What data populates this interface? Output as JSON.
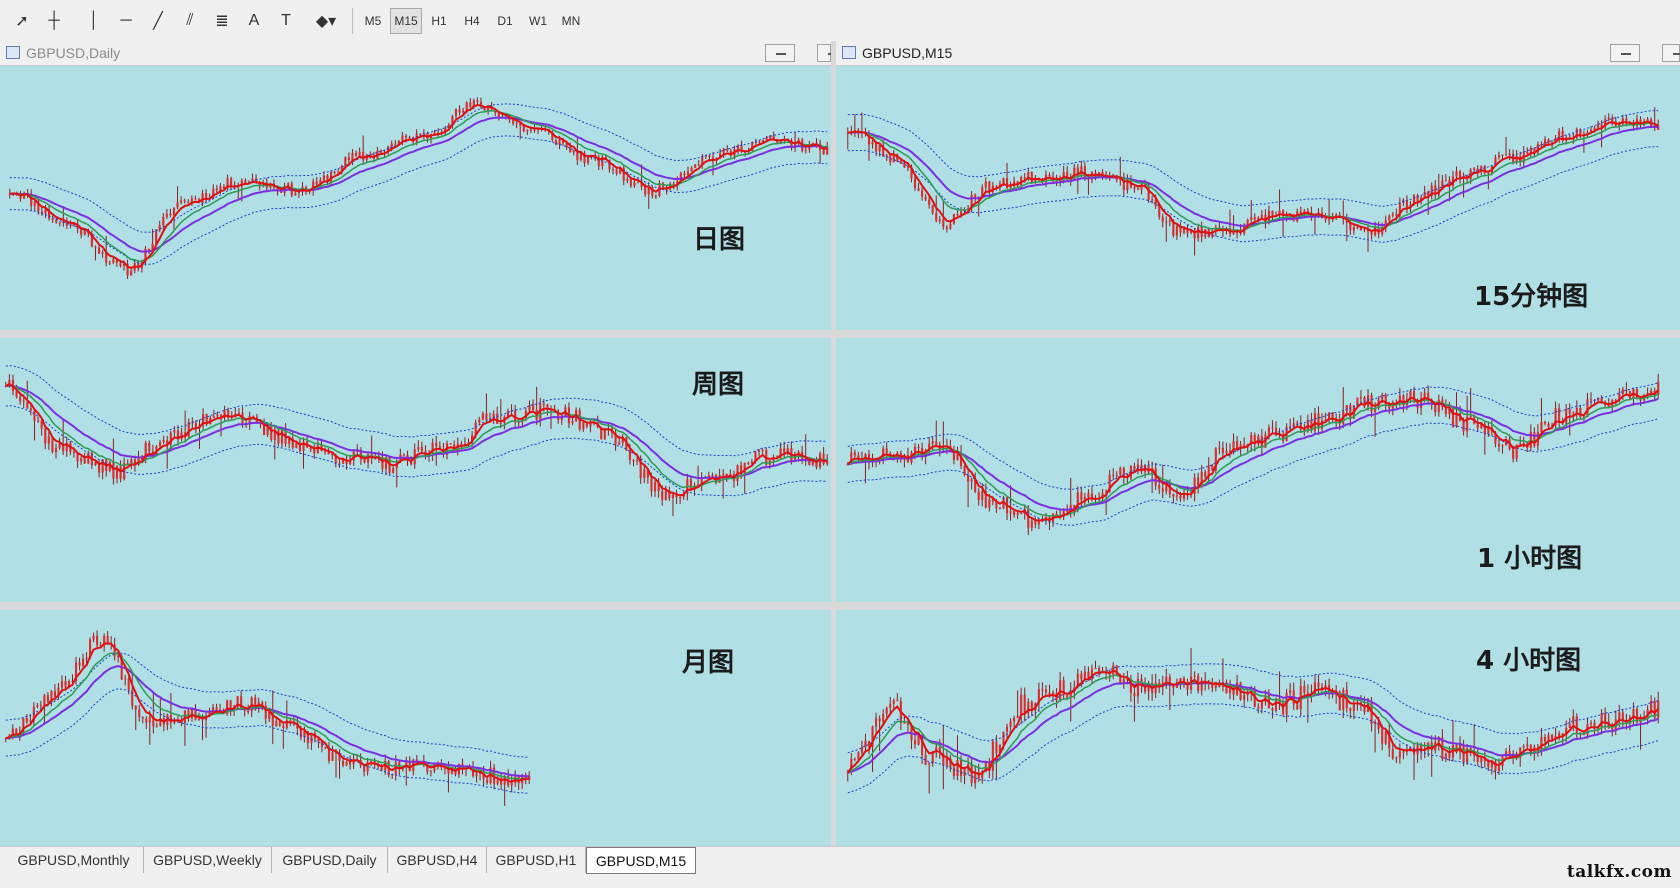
{
  "toolbar": {
    "tools": [
      {
        "name": "cursor-icon",
        "glyph": "➚"
      },
      {
        "name": "crosshair-icon",
        "glyph": "┼"
      },
      {
        "name": "vertical-line-icon",
        "glyph": "│"
      },
      {
        "name": "horizontal-line-icon",
        "glyph": "─"
      },
      {
        "name": "trendline-icon",
        "glyph": "╱"
      },
      {
        "name": "equidistant-channel-icon",
        "glyph": "⫽"
      },
      {
        "name": "fibonacci-icon",
        "glyph": "≣"
      },
      {
        "name": "text-icon",
        "glyph": "A"
      },
      {
        "name": "text-label-icon",
        "glyph": "T"
      },
      {
        "name": "arrows-dropdown-icon",
        "glyph": "◆▾"
      }
    ],
    "timeframes": [
      "M5",
      "M15",
      "H1",
      "H4",
      "D1",
      "W1",
      "MN"
    ],
    "active_timeframe": "M15"
  },
  "windows": [
    {
      "id": "daily",
      "title": "GBPUSD,Daily",
      "label": "日图",
      "active": false
    },
    {
      "id": "m15",
      "title": "GBPUSD,M15",
      "label": "15分钟图",
      "active": true
    },
    {
      "id": "weekly",
      "title": "",
      "label": "周图"
    },
    {
      "id": "h1",
      "title": "",
      "label": "1 小时图"
    },
    {
      "id": "monthly",
      "title": "",
      "label": "月图"
    },
    {
      "id": "h4",
      "title": "",
      "label": "4 小时图"
    }
  ],
  "tabs": [
    "GBPUSD,Monthly",
    "GBPUSD,Weekly",
    "GBPUSD,Daily",
    "GBPUSD,H4",
    "GBPUSD,H1",
    "GBPUSD,M15"
  ],
  "active_tab": "GBPUSD,M15",
  "watermark": "talkfx.com",
  "colors": {
    "chart_bg": "#b0dfe5",
    "candle": "#d62f2f",
    "ma_fast": "#e01010",
    "ma_mid": "#2e9b54",
    "ma_slow": "#7b2fe0",
    "band": "#1a3fcf"
  }
}
